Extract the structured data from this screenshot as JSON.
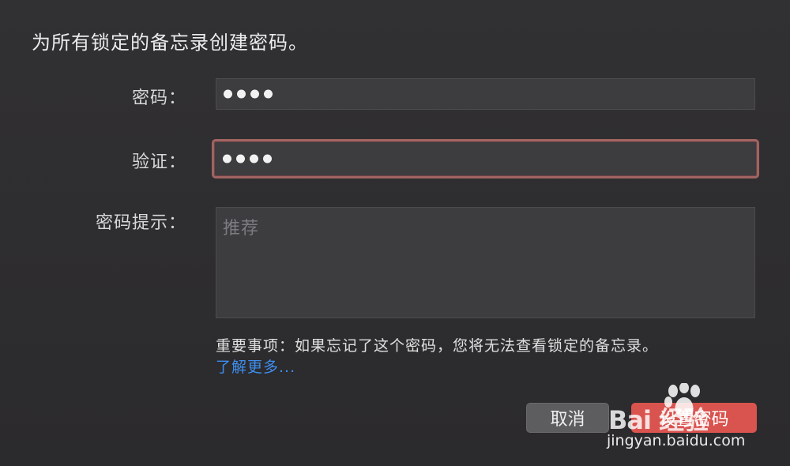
{
  "dialog": {
    "title": "为所有锁定的备忘录创建密码。"
  },
  "fields": {
    "password_label": "密码：",
    "verify_label": "验证：",
    "hint_label": "密码提示：",
    "hint_placeholder": "推荐"
  },
  "notice": {
    "text": "重要事项：如果忘记了这个密码，您将无法查看锁定的备忘录。",
    "learn_more": "了解更多..."
  },
  "buttons": {
    "cancel": "取消",
    "set_password": "设置密码"
  },
  "watermark": {
    "logo_text": "Bai  经验",
    "url": "jingyan.baidu.com"
  },
  "colors": {
    "background": "#2c2b2d",
    "field_bg": "#3d3c3f",
    "focus_ring": "#a06462",
    "link": "#3d8ef0",
    "primary_button": "#d9534f",
    "cancel_button": "#5d5c5f"
  },
  "icons": {
    "password_mask": "bullet-dot",
    "watermark_logo": "baidu-paw-icon"
  }
}
